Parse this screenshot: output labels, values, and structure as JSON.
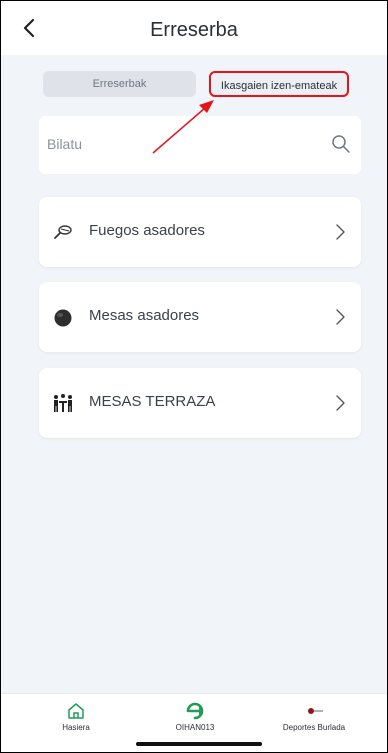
{
  "header": {
    "title": "Erreserba",
    "back_icon": "chevron-left-icon"
  },
  "tabs": [
    {
      "label": "Erreserbak",
      "selected": false
    },
    {
      "label": "Ikasgaien izen-emateak",
      "highlighted": true
    }
  ],
  "search": {
    "placeholder": "Bilatu",
    "icon": "search-icon"
  },
  "items": [
    {
      "label": "Fuegos asadores",
      "icon": "grill-icon"
    },
    {
      "label": "Mesas asadores",
      "icon": "round-table-icon"
    },
    {
      "label": "MESAS TERRAZA",
      "icon": "terrace-tables-icon"
    }
  ],
  "bottom_nav": [
    {
      "label": "Hasiera",
      "icon": "home-icon"
    },
    {
      "label": "OIHAN013",
      "icon": "app-logo-icon"
    },
    {
      "label": "Deportes Burlada",
      "icon": "club-logo-icon"
    }
  ],
  "colors": {
    "background": "#f1f4f8",
    "highlight": "#e3141a",
    "accent_green": "#1f9d55"
  }
}
